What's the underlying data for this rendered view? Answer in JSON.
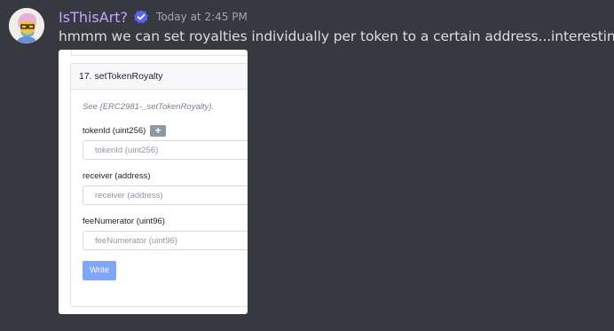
{
  "message": {
    "username": "IsThisArt?",
    "timestamp": "Today at 2:45 PM",
    "text": "hmmm we can set royalties individually per token to a certain address...interesting",
    "avatar_icon": "cartoon-face-avatar",
    "verified_icon": "verified-badge-icon",
    "colors": {
      "username": "#c6a6ff",
      "background": "#36393f",
      "verified": "#5865f2"
    }
  },
  "embed": {
    "section_title": "17. setTokenRoyalty",
    "see_text": "See {ERC2981-_setTokenRoyalty}.",
    "fields": [
      {
        "label": "tokenId (uint256)",
        "placeholder": "tokenId (uint256)",
        "has_add_button": true,
        "add_label": "+"
      },
      {
        "label": "receiver (address)",
        "placeholder": "receiver (address)"
      },
      {
        "label": "feeNumerator (uint96)",
        "placeholder": "feeNumerator (uint96)"
      }
    ],
    "write_label": "Write",
    "colors": {
      "write_button": "#7fa7fb",
      "add_button": "#8c98a4"
    }
  }
}
